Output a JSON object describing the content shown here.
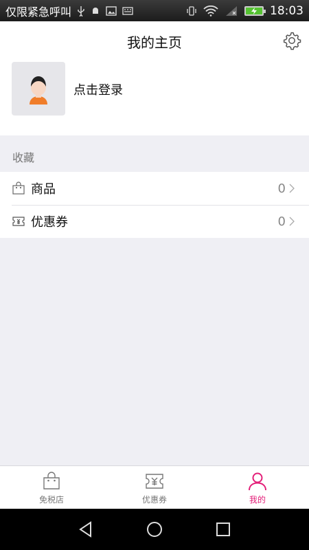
{
  "status_bar": {
    "notification_text": "仅限紧急呼叫",
    "time": "18:03"
  },
  "header": {
    "title": "我的主页"
  },
  "profile": {
    "login_text": "点击登录"
  },
  "favorites": {
    "section_label": "收藏",
    "items": [
      {
        "label": "商品",
        "count": "0",
        "icon": "shopping-bag-icon"
      },
      {
        "label": "优惠券",
        "count": "0",
        "icon": "coupon-icon"
      }
    ]
  },
  "tabbar": {
    "tabs": [
      {
        "label": "免税店",
        "icon": "shopping-bag-icon",
        "active": false
      },
      {
        "label": "优惠券",
        "icon": "coupon-icon",
        "active": false
      },
      {
        "label": "我的",
        "icon": "person-icon",
        "active": true
      }
    ]
  },
  "colors": {
    "accent": "#e31e78",
    "background": "#efeff4"
  }
}
